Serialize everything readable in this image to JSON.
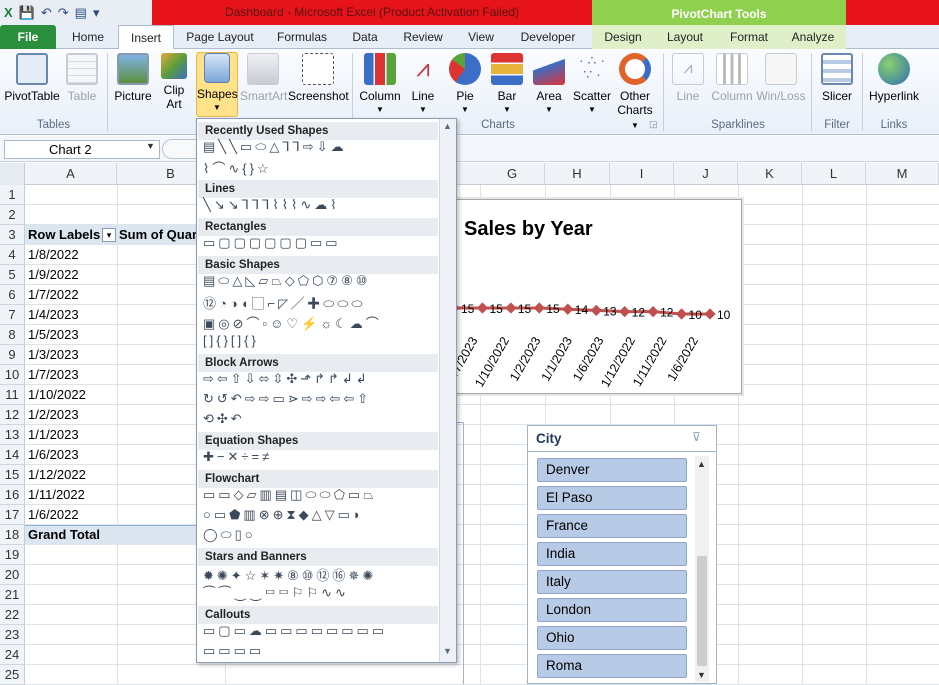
{
  "window": {
    "title": "Dashboard  -  Microsoft Excel (Product Activation Failed)",
    "context_tools": "PivotChart Tools"
  },
  "tabs": {
    "file": "File",
    "home": "Home",
    "insert": "Insert",
    "page_layout": "Page Layout",
    "formulas": "Formulas",
    "data": "Data",
    "review": "Review",
    "view": "View",
    "developer": "Developer",
    "design": "Design",
    "layout": "Layout",
    "format": "Format",
    "analyze": "Analyze"
  },
  "ribbon": {
    "pivottable": "PivotTable",
    "table": "Table",
    "picture": "Picture",
    "clip_art_1": "Clip",
    "clip_art_2": "Art",
    "shapes": "Shapes",
    "smartart": "SmartArt",
    "screenshot": "Screenshot",
    "column": "Column",
    "line": "Line",
    "pie": "Pie",
    "bar": "Bar",
    "area": "Area",
    "scatter": "Scatter",
    "other_1": "Other",
    "other_2": "Charts",
    "spark_line": "Line",
    "spark_column": "Column",
    "spark_winloss": "Win/Loss",
    "slicer": "Slicer",
    "hyperlink": "Hyperlink",
    "groups": {
      "tables": "Tables",
      "charts": "Charts",
      "sparklines": "Sparklines",
      "filter": "Filter",
      "links": "Links"
    }
  },
  "name_box": "Chart 2",
  "columns": [
    "A",
    "B",
    "G",
    "H",
    "I",
    "J",
    "K",
    "L",
    "M"
  ],
  "rows": [
    "1",
    "2",
    "3",
    "4",
    "5",
    "6",
    "7",
    "8",
    "9",
    "10",
    "11",
    "12",
    "13",
    "14",
    "15",
    "16",
    "17",
    "18",
    "19",
    "20",
    "21",
    "22",
    "23",
    "24",
    "25"
  ],
  "pivot": {
    "row_labels": "Row Labels",
    "sum_header": "Sum of Quar",
    "items": [
      "1/8/2022",
      "1/9/2022",
      "1/7/2022",
      "1/4/2023",
      "1/5/2023",
      "1/3/2023",
      "1/7/2023",
      "1/10/2022",
      "1/2/2023",
      "1/1/2023",
      "1/6/2023",
      "1/12/2022",
      "1/11/2022",
      "1/6/2022"
    ],
    "grand_total": "Grand Total"
  },
  "chart_data": {
    "type": "line",
    "title": "Sales by Year",
    "categories": [
      "1/7/2023",
      "1/10/2022",
      "1/2/2023",
      "1/1/2023",
      "1/6/2023",
      "1/12/2022",
      "1/11/2022",
      "1/6/2022"
    ],
    "data_labels": [
      "15",
      "15",
      "15",
      "15",
      "14",
      "13",
      "12",
      "12",
      "10",
      "10"
    ],
    "series": [
      {
        "values": [
          15,
          15,
          15,
          15,
          14,
          13,
          12,
          12,
          10,
          10
        ]
      }
    ],
    "line_color": "#c0504d"
  },
  "shapes_menu": {
    "sections": [
      "Recently Used Shapes",
      "Lines",
      "Rectangles",
      "Basic Shapes",
      "Block Arrows",
      "Equation Shapes",
      "Flowchart",
      "Stars and Banners",
      "Callouts"
    ],
    "rows": {
      "recent1": "▤╲╲▭⬭△⅂⅂⇨⇩☁",
      "recent2": "⌇⌒∿{}☆",
      "lines": "╲↘↘⅂⅂⅂⌇⌇⌇∿☁⌇",
      "rect": "▭▢▢▢▢▢▢▭▭",
      "basic1": "▤⬭△◺▱⏢◇⬠⬡⑦⑧⑩",
      "basic2": "⑫◔◑◖▢⌐◸╱✚⬭⬭⬭",
      "basic3": "▣◎⊘⌒▫☺♡⚡☼☾☁⌒",
      "basic4": "[]{}[]{}",
      "arrows1": "⇨⇦⇧⇩⬄⇳✣⬏↱↱↲↲",
      "arrows2": "↻↺↶⇨⇨▭⋗⇨⇨⇦⇦⇧",
      "arrows3": "⟲✣↶",
      "equation": "✚−✕÷=≠",
      "flow1": "▭▭◇▱▥▤◫⬭⬭⬠▭⏢",
      "flow2": "○▭⬟▥⊗⊕⧗◆△▽▭◗",
      "flow3": "◯⬭▯○",
      "stars1": "✹✺✦☆✶✷⑧⑩⑫⑯✵✺",
      "stars2": "⏜⏜⏝⏝▭▭⚐⚐∿∿",
      "call1": "▭▢▭☁▭▭▭▭▭▭▭▭",
      "call2": "▭▭▭▭"
    }
  },
  "slicer": {
    "title": "City",
    "items": [
      "Denver",
      "El Paso",
      "France",
      "India",
      "Italy",
      "London",
      "Ohio",
      "Roma"
    ]
  }
}
